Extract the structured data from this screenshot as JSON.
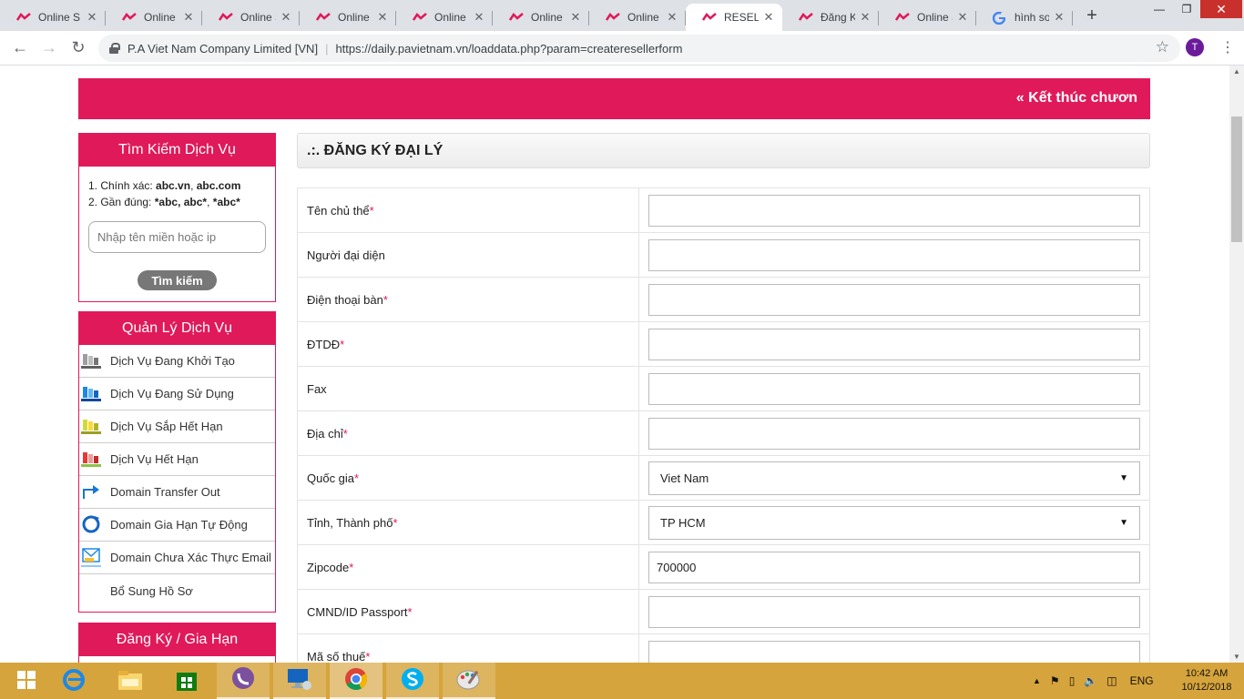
{
  "browser": {
    "tabs": [
      {
        "label": "Online S",
        "active": false
      },
      {
        "label": "Online S",
        "active": false
      },
      {
        "label": "Online S",
        "active": false
      },
      {
        "label": "Online S",
        "active": false
      },
      {
        "label": "Online S",
        "active": false
      },
      {
        "label": "Online S",
        "active": false
      },
      {
        "label": "Online S",
        "active": false
      },
      {
        "label": "RESELLE",
        "active": true
      },
      {
        "label": "Đăng K",
        "active": false
      },
      {
        "label": "Online S",
        "active": false
      },
      {
        "label": "hình sơ",
        "active": false
      }
    ],
    "site_name": "P.A Viet Nam Company Limited [VN]",
    "url": "https://daily.pavietnam.vn/loaddata.php?param=createresellerform",
    "profile_initial": "T"
  },
  "banner": {
    "marquee": "« Kết thúc chươn"
  },
  "search_box": {
    "title": "Tìm Kiếm Dịch Vụ",
    "hint1_prefix": "1. Chính xác: ",
    "hint1_bold": "abc.vn",
    "hint1_sep": ", ",
    "hint1_bold2": "abc.com",
    "hint2_prefix": "2. Gần đúng: ",
    "hint2_bold": "*abc, abc*",
    "hint2_sep": ", ",
    "hint2_bold2": "*abc*",
    "placeholder": "Nhập tên miền hoặc ip",
    "button": "Tìm kiếm"
  },
  "service_box": {
    "title": "Quản Lý Dịch Vụ",
    "items": [
      {
        "label": "Dịch Vụ Đang Khởi Tạo",
        "icon": "server-gray-icon"
      },
      {
        "label": "Dịch Vụ Đang Sử Dụng",
        "icon": "server-blue-icon"
      },
      {
        "label": "Dịch Vụ Sắp Hết Hạn",
        "icon": "server-yellow-icon"
      },
      {
        "label": "Dịch Vụ Hết Hạn",
        "icon": "server-red-icon"
      },
      {
        "label": "Domain Transfer Out",
        "icon": "transfer-arrow-icon"
      },
      {
        "label": "Domain Gia Hạn Tự Động",
        "icon": "refresh-icon"
      },
      {
        "label": "Domain Chưa Xác Thực Email",
        "icon": "email-verify-icon"
      },
      {
        "label": "Bổ Sung Hồ Sơ",
        "icon": ""
      }
    ]
  },
  "register_box": {
    "title": "Đăng Ký / Gia Hạn"
  },
  "form": {
    "title": ".:. ĐĂNG KÝ ĐẠI LÝ",
    "fields": [
      {
        "label": "Tên chủ thể",
        "required": true,
        "type": "text",
        "value": ""
      },
      {
        "label": "Người đại diện",
        "required": false,
        "type": "text",
        "value": ""
      },
      {
        "label": "Điện thoại bàn",
        "required": true,
        "type": "text",
        "value": ""
      },
      {
        "label": "ĐTDĐ",
        "required": true,
        "type": "text",
        "value": ""
      },
      {
        "label": "Fax",
        "required": false,
        "type": "text",
        "value": ""
      },
      {
        "label": "Địa chỉ",
        "required": true,
        "type": "text",
        "value": ""
      },
      {
        "label": "Quốc gia",
        "required": true,
        "type": "select",
        "value": "Viet Nam"
      },
      {
        "label": "Tỉnh, Thành phố",
        "required": true,
        "type": "select",
        "value": "TP HCM"
      },
      {
        "label": "Zipcode",
        "required": true,
        "type": "text",
        "value": "700000"
      },
      {
        "label": "CMND/ID Passport",
        "required": true,
        "type": "text",
        "value": ""
      },
      {
        "label": "Mã số thuế",
        "required": true,
        "type": "text",
        "value": ""
      }
    ]
  },
  "taskbar": {
    "items": [
      "start-icon",
      "internet-explorer-icon",
      "file-explorer-icon",
      "store-icon",
      "viber-icon",
      "remote-desktop-icon",
      "chrome-icon",
      "skype-icon",
      "paint-icon"
    ],
    "lang": "ENG",
    "time": "10:42 AM",
    "date": "10/12/2018"
  },
  "colors": {
    "brand": "#e0195a",
    "taskbar": "#d6a43c"
  }
}
